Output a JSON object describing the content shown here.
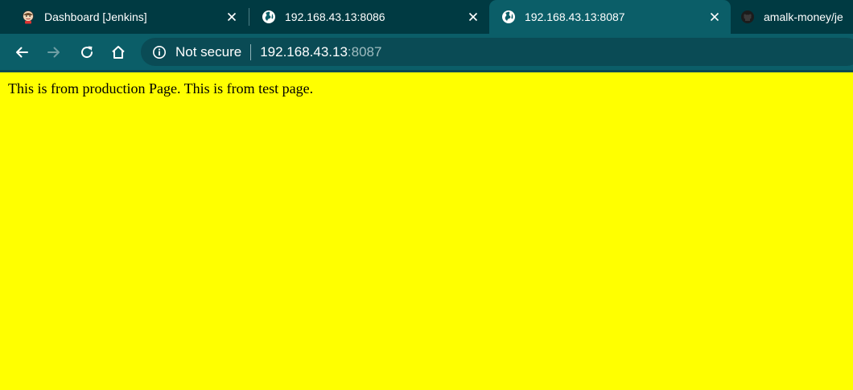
{
  "browser": {
    "tabs": [
      {
        "title": "Dashboard [Jenkins]",
        "icon": "jenkins-icon",
        "active": false
      },
      {
        "title": "192.168.43.13:8086",
        "icon": "globe-icon",
        "active": false
      },
      {
        "title": "192.168.43.13:8087",
        "icon": "globe-icon",
        "active": true
      },
      {
        "title": "amalk-money/je",
        "icon": "github-icon",
        "active": false
      }
    ],
    "address": {
      "security_label": "Not secure",
      "host": "192.168.43.13",
      "port": ":8087"
    },
    "colors": {
      "tab_strip": "#003a42",
      "toolbar": "#0b5e68",
      "omnibox": "#0a4b55"
    }
  },
  "page": {
    "text": "This is from production Page. This is from test page.",
    "background": "#ffff00"
  }
}
